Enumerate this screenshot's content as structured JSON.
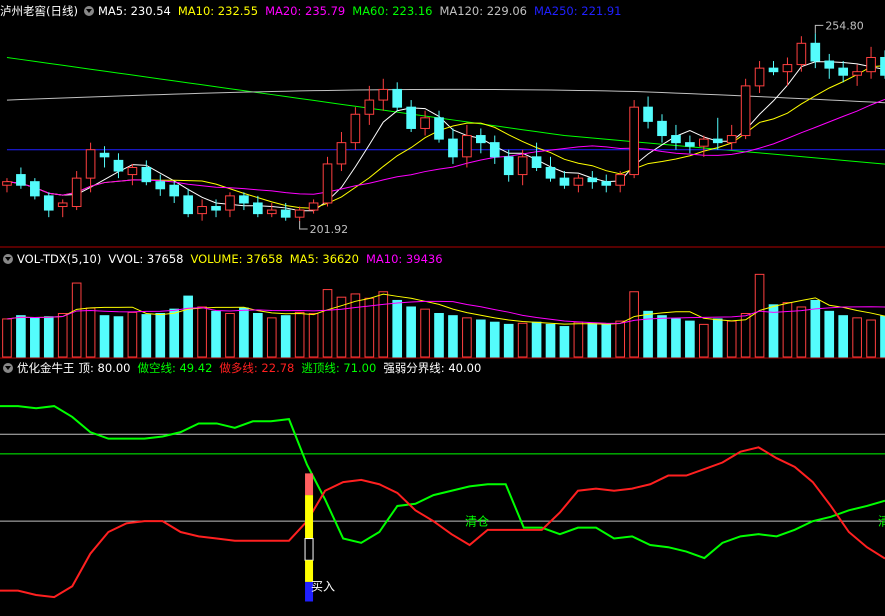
{
  "colors": {
    "up": "#ff4040",
    "down": "#54fcfc",
    "ma5": "#ffffff",
    "ma10": "#ffff00",
    "ma20": "#ff00ff",
    "ma60": "#00ff00",
    "ma120": "#c0c0c0",
    "ma250": "#2020ff",
    "kong": "#00ff00",
    "duo": "#ff2020",
    "ref_line": "#c0c0c0",
    "ding_line": "#00ff00"
  },
  "price_panel": {
    "header": {
      "title": "泸州老窖(日线)",
      "ma_labels": [
        {
          "text": "MA5: 230.54",
          "color": "#ffffff"
        },
        {
          "text": "MA10: 232.55",
          "color": "#ffff00"
        },
        {
          "text": "MA20: 235.79",
          "color": "#ff00ff"
        },
        {
          "text": "MA60: 223.16",
          "color": "#00ff00"
        },
        {
          "text": "MA120: 229.06",
          "color": "#c0c0c0"
        },
        {
          "text": "MA250: 221.91",
          "color": "#2020ff"
        }
      ]
    },
    "high_marker": "254.80",
    "low_marker": "201.92"
  },
  "volume_panel": {
    "header": {
      "title": "VOL-TDX(5,10)",
      "labels": [
        {
          "text": "VVOL: 37658",
          "color": "#ffffff"
        },
        {
          "text": "VOLUME: 37658",
          "color": "#ffff00"
        },
        {
          "text": "MA5: 36620",
          "color": "#ffff00"
        },
        {
          "text": "MA10: 39436",
          "color": "#ff00ff"
        }
      ]
    }
  },
  "indicator_panel": {
    "header": {
      "title": "优化金牛王",
      "labels": [
        {
          "text": "顶: 80.00",
          "color": "#ffffff"
        },
        {
          "text": "做空线: 49.42",
          "color": "#00ff00"
        },
        {
          "text": "做多线: 22.78",
          "color": "#ff2020"
        },
        {
          "text": "逃顶线: 71.00",
          "color": "#00ff00"
        },
        {
          "text": "强弱分界线: 40.00",
          "color": "#ffffff"
        }
      ]
    },
    "annotations": {
      "buy": "买入",
      "clear": "清仓",
      "clear_edge": "清"
    }
  },
  "chart_data": [
    {
      "type": "candlestick",
      "title": "泸州老窖(日线)",
      "note": "approximate OHLC read from chart",
      "ohlc": [
        [
          212,
          214,
          210,
          213
        ],
        [
          215,
          217,
          211,
          212
        ],
        [
          213,
          214,
          208,
          209
        ],
        [
          209,
          210,
          203,
          205
        ],
        [
          206,
          208,
          203,
          207
        ],
        [
          206,
          216,
          205,
          214
        ],
        [
          214,
          224,
          210,
          222
        ],
        [
          221,
          223,
          217,
          220
        ],
        [
          219,
          221,
          214,
          216
        ],
        [
          215,
          218,
          212,
          217
        ],
        [
          217,
          219,
          212,
          213
        ],
        [
          213,
          215,
          209,
          211
        ],
        [
          212,
          213,
          207,
          209
        ],
        [
          209,
          211,
          203,
          204
        ],
        [
          204,
          208,
          202,
          206
        ],
        [
          206,
          208,
          203,
          205
        ],
        [
          205,
          210,
          203,
          209
        ],
        [
          209,
          210,
          205,
          207
        ],
        [
          207,
          209,
          203,
          204
        ],
        [
          204,
          207,
          203,
          205
        ],
        [
          205,
          207,
          202,
          203
        ],
        [
          203,
          206,
          201.92,
          205
        ],
        [
          205,
          208,
          204,
          207
        ],
        [
          207,
          220,
          206,
          218
        ],
        [
          218,
          227,
          216,
          224
        ],
        [
          224,
          234,
          222,
          232
        ],
        [
          232,
          240,
          229,
          236
        ],
        [
          236,
          242,
          233,
          239
        ],
        [
          239,
          241,
          233,
          234
        ],
        [
          234,
          236,
          227,
          228
        ],
        [
          228,
          233,
          226,
          231
        ],
        [
          231,
          233,
          224,
          225
        ],
        [
          225,
          228,
          218,
          220
        ],
        [
          220,
          229,
          217,
          226
        ],
        [
          226,
          228,
          221,
          224
        ],
        [
          224,
          226,
          218,
          220
        ],
        [
          220,
          222,
          213,
          215
        ],
        [
          215,
          222,
          212,
          220
        ],
        [
          220,
          224,
          216,
          217
        ],
        [
          217,
          220,
          213,
          214
        ],
        [
          214,
          216,
          211,
          212
        ],
        [
          212,
          215,
          210,
          214
        ],
        [
          214,
          216,
          211,
          213
        ],
        [
          213,
          215,
          210,
          212
        ],
        [
          212,
          216,
          210,
          215
        ],
        [
          215,
          236,
          214,
          234
        ],
        [
          234,
          237,
          228,
          230
        ],
        [
          230,
          232,
          224,
          226
        ],
        [
          226,
          229,
          222,
          224
        ],
        [
          224,
          226,
          221,
          223
        ],
        [
          223,
          226,
          220,
          225
        ],
        [
          225,
          231,
          222,
          224
        ],
        [
          224,
          229,
          222,
          226
        ],
        [
          226,
          242,
          225,
          240
        ],
        [
          240,
          247,
          238,
          245
        ],
        [
          245,
          247,
          243,
          244
        ],
        [
          244,
          248,
          240,
          246
        ],
        [
          246,
          254,
          244,
          252
        ],
        [
          252,
          254.8,
          245,
          247
        ],
        [
          247,
          249,
          242,
          245
        ],
        [
          245,
          247,
          241,
          243
        ],
        [
          243,
          246,
          240,
          244
        ],
        [
          244,
          251,
          242,
          248
        ],
        [
          248,
          250,
          242,
          243
        ]
      ]
    },
    {
      "type": "bar",
      "title": "VOL-TDX(5,10)",
      "note": "approximate volume, up=red hollow, down=cyan filled",
      "values": [
        35000,
        38000,
        36000,
        37000,
        40000,
        68000,
        45000,
        38000,
        37000,
        41000,
        39000,
        40000,
        44000,
        56000,
        46000,
        42000,
        40000,
        45000,
        40000,
        36000,
        38000,
        41000,
        40000,
        62000,
        55000,
        58000,
        54000,
        60000,
        52000,
        46000,
        44000,
        40000,
        38000,
        36000,
        34000,
        32000,
        30000,
        31000,
        32000,
        30000,
        28000,
        32000,
        31000,
        30000,
        33000,
        60000,
        42000,
        38000,
        35000,
        33000,
        30000,
        35000,
        33000,
        40000,
        76000,
        48000,
        50000,
        46000,
        52000,
        42000,
        38000,
        36000,
        34000,
        37658
      ]
    },
    {
      "type": "line",
      "title": "优化金牛王",
      "x_count": 64,
      "series": [
        {
          "name": "做空线",
          "color": "#00ff00",
          "values": [
            93,
            93,
            92,
            93,
            88,
            81,
            78,
            78,
            78,
            79,
            81,
            85,
            85,
            83,
            86,
            86,
            87,
            66,
            50,
            32,
            30,
            35,
            47,
            48,
            52,
            54,
            56,
            57,
            57,
            37,
            37,
            34,
            37,
            37,
            32,
            33,
            29,
            28,
            26,
            23,
            30,
            33,
            34,
            33,
            36,
            40,
            42,
            45,
            47,
            49.42
          ]
        },
        {
          "name": "做多线",
          "color": "#ff2020",
          "values": [
            8,
            8,
            6,
            5,
            10,
            25,
            35,
            39,
            40,
            40,
            35,
            33,
            32,
            31,
            31,
            31,
            31,
            40,
            54,
            58,
            59,
            57,
            53,
            45,
            40,
            34,
            29,
            36,
            36,
            36,
            36,
            44,
            54,
            55,
            54,
            55,
            57,
            61,
            61,
            64,
            67,
            72,
            74,
            69,
            65,
            58,
            47,
            35,
            28,
            22.78
          ]
        }
      ],
      "reference_lines": [
        {
          "name": "顶",
          "value": 80,
          "color": "#c0c0c0"
        },
        {
          "name": "逃顶线",
          "value": 71,
          "color": "#00ff00"
        },
        {
          "name": "强弱分界线",
          "value": 40,
          "color": "#c0c0c0"
        }
      ]
    }
  ]
}
